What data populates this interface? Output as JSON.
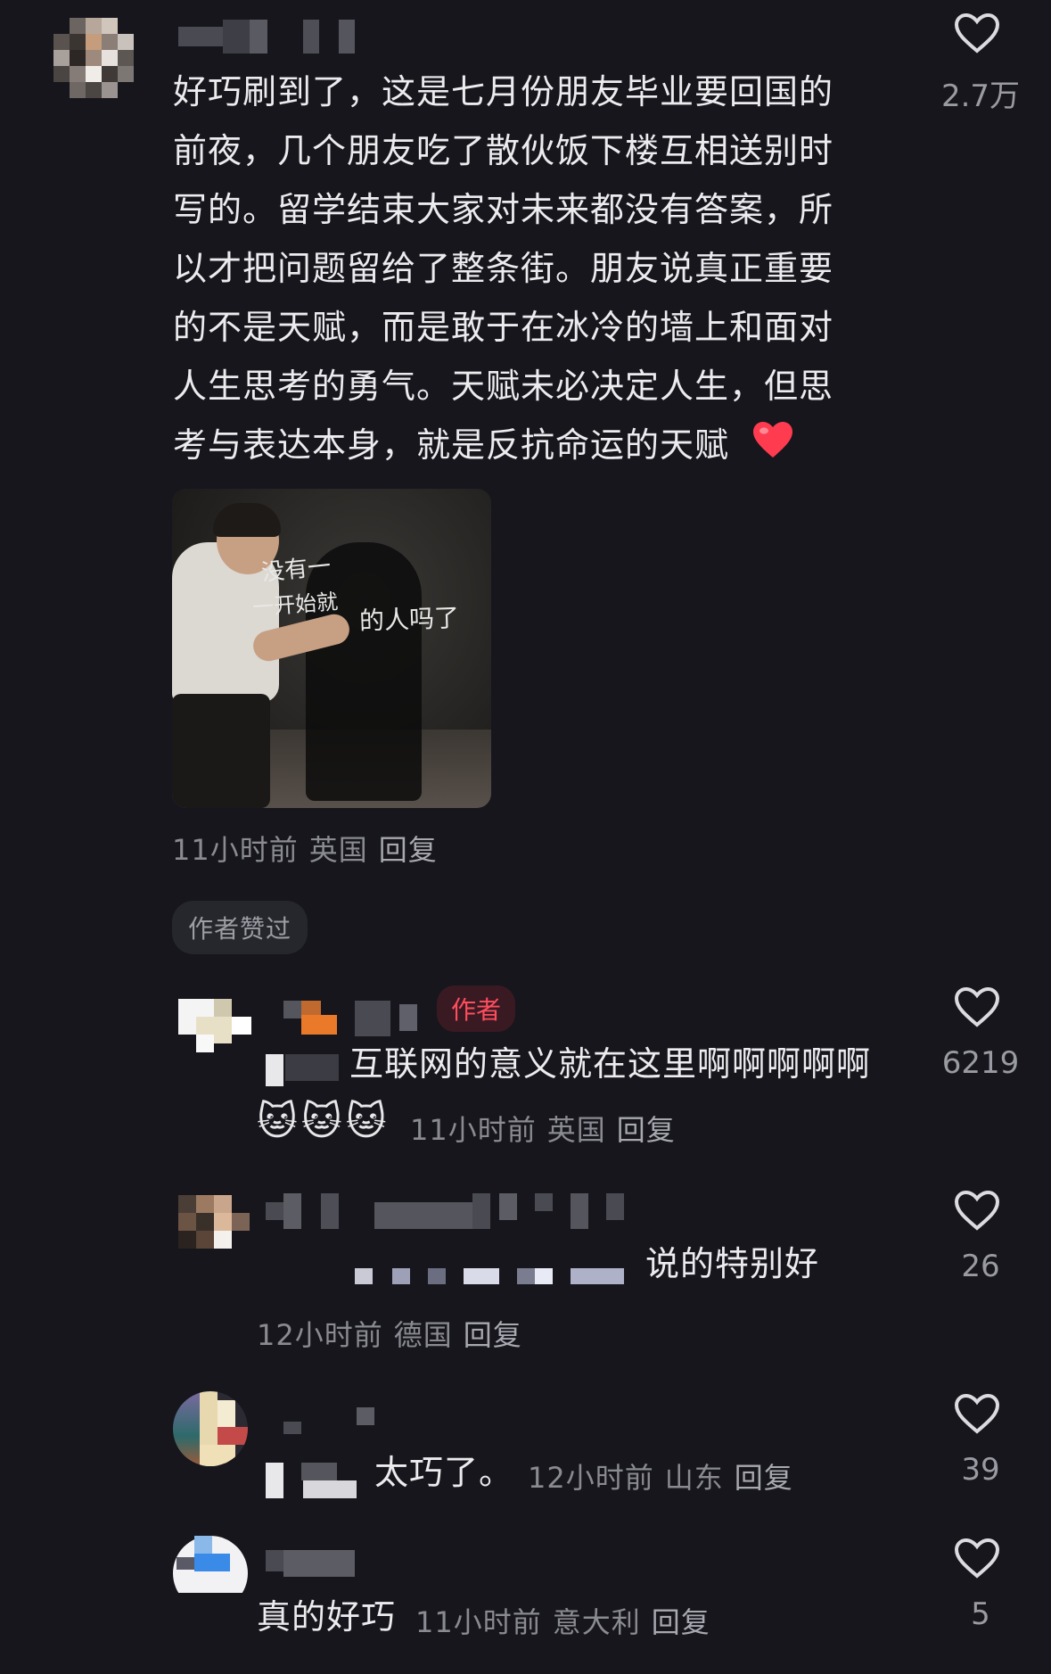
{
  "comments": [
    {
      "text_lines": [
        "好巧刷到了，这是七月份朋友毕业要回国的",
        "前夜，几个朋友吃了散伙饭下楼互相送别时",
        "写的。留学结束大家对未来都没有答案，所",
        "以才把问题留给了整条街。朋友说真正重要",
        "的不是天赋，而是敢于在冰冷的墙上和面对",
        "人生思考的勇气。天赋未必决定人生，但思",
        "考与表达本身，就是反抗命运的天赋"
      ],
      "emoji": "❤️",
      "time": "11小时前",
      "location": "英国",
      "reply": "回复",
      "likes": "2.7万",
      "badge": "作者赞过",
      "photo_handwriting": [
        "没有一",
        "一开始就",
        "的人吗了"
      ]
    },
    {
      "author_tag": "作者",
      "text": "互联网的意义就在这里啊啊啊啊啊",
      "emoji_stickers": [
        "🐱",
        "🐱",
        "🐱"
      ],
      "time": "11小时前",
      "location": "英国",
      "reply": "回复",
      "likes": "6219"
    },
    {
      "text": "说的特别好",
      "time": "12小时前",
      "location": "德国",
      "reply": "回复",
      "likes": "26"
    },
    {
      "text": "太巧了。",
      "time": "12小时前",
      "location": "山东",
      "reply": "回复",
      "likes": "39"
    },
    {
      "text": "真的好巧",
      "time": "11小时前",
      "location": "意大利",
      "reply": "回复",
      "likes": "5"
    }
  ],
  "colors": {
    "background": "#16161c",
    "author_tag": "#ff4d5e",
    "heart_emoji": "#ff3b4f"
  }
}
